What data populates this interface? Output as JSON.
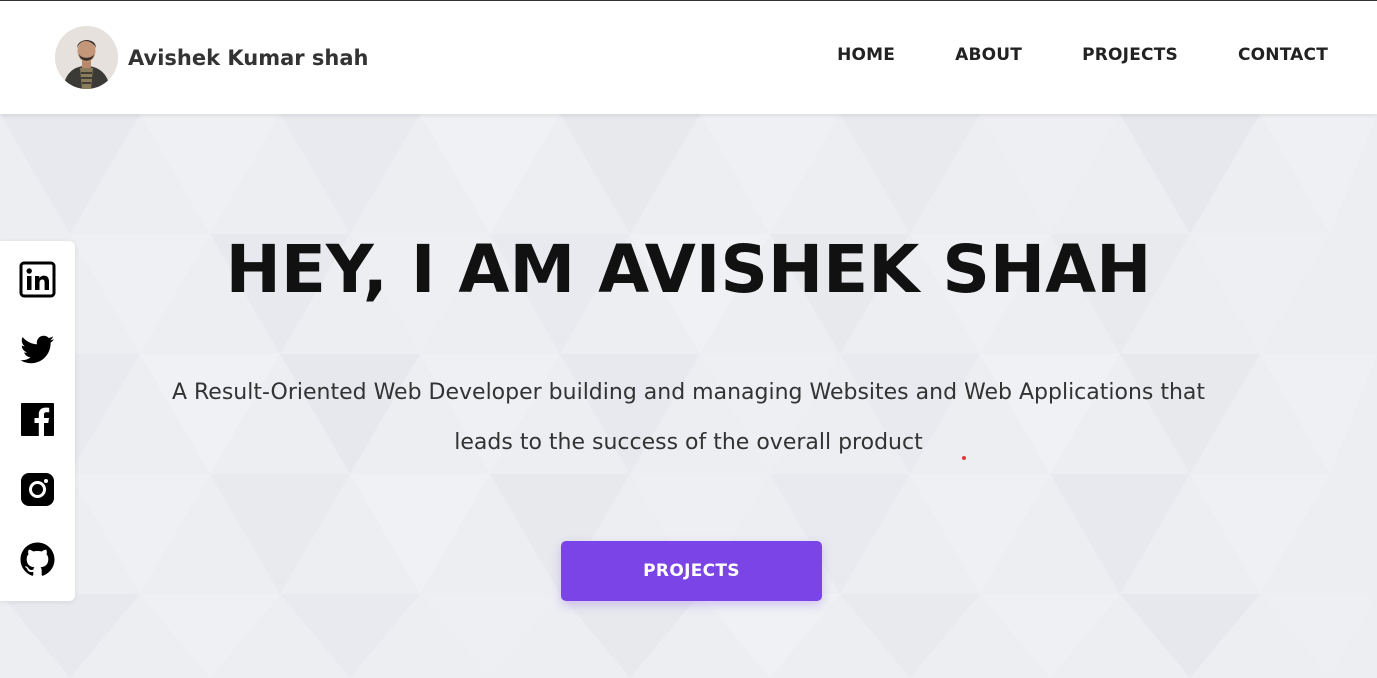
{
  "header": {
    "brand_name": "Avishek Kumar shah",
    "avatar_icon": "profile-photo",
    "nav": [
      {
        "label": "HOME"
      },
      {
        "label": "ABOUT"
      },
      {
        "label": "PROJECTS"
      },
      {
        "label": "CONTACT"
      }
    ]
  },
  "hero": {
    "title": "HEY, I AM AVISHEK SHAH",
    "subtitle": "A Result-Oriented Web Developer building and managing Websites and Web Applications that leads to the success of the overall product",
    "cta_label": "PROJECTS"
  },
  "social": [
    {
      "icon": "linkedin-icon"
    },
    {
      "icon": "twitter-icon"
    },
    {
      "icon": "facebook-icon"
    },
    {
      "icon": "instagram-icon"
    },
    {
      "icon": "github-icon"
    }
  ],
  "colors": {
    "accent": "#7a44e6",
    "hero_background": "#eceef2",
    "heading": "#111111",
    "body_text": "#333333"
  }
}
